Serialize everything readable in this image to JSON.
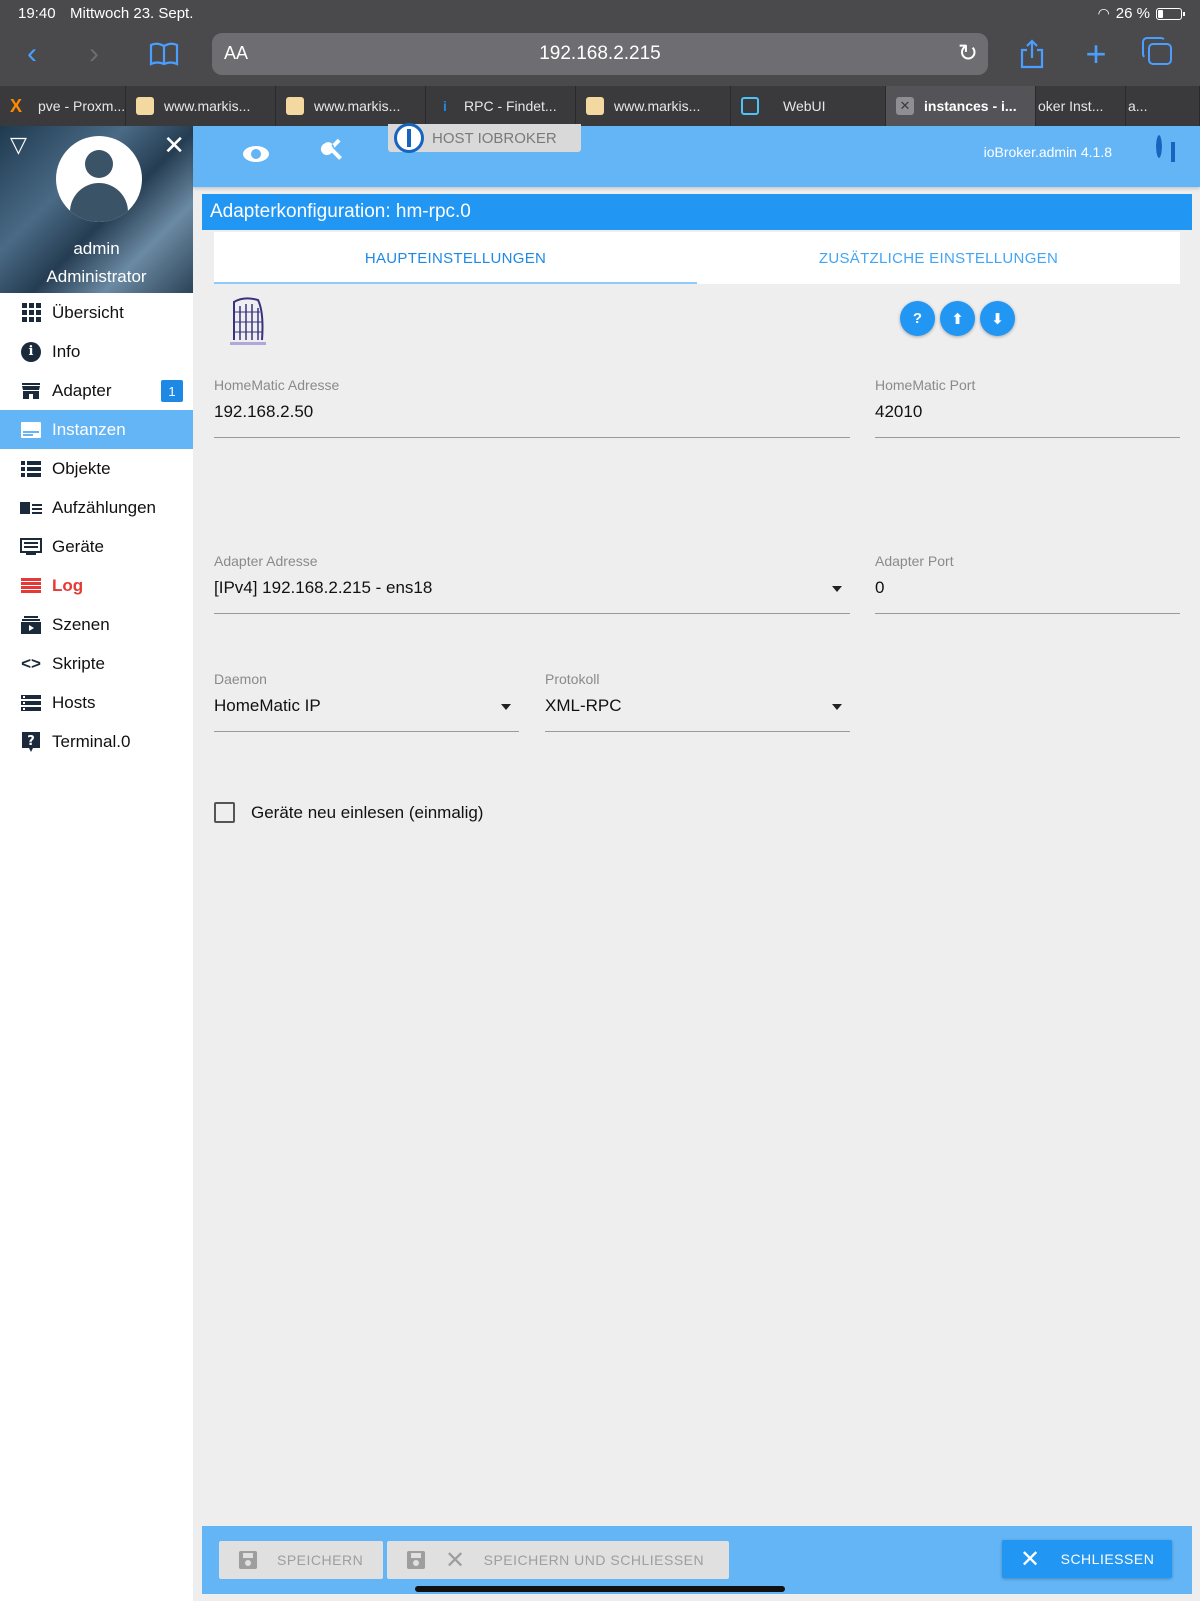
{
  "status": {
    "time": "19:40",
    "date": "Mittwoch 23. Sept.",
    "battery": "26 %"
  },
  "safari": {
    "aa_label": "AA",
    "url": "192.168.2.215"
  },
  "browser_tabs": [
    {
      "label": "pve - Proxm...",
      "icon_color": "#ff8a00"
    },
    {
      "label": "www.markis...",
      "icon_color": "#d46a2a"
    },
    {
      "label": "www.markis...",
      "icon_color": "#d46a2a"
    },
    {
      "label": "RPC - Findet...",
      "icon_color": "#1e88e5"
    },
    {
      "label": "www.markis...",
      "icon_color": "#d46a2a"
    },
    {
      "label": "WebUI",
      "icon_color": "#4fc3f7"
    },
    {
      "label": "instances - i...",
      "icon_color": "#8e8e93"
    },
    {
      "label": "oker Inst...",
      "icon_color": ""
    },
    {
      "label": "a...",
      "icon_color": ""
    }
  ],
  "sidebar": {
    "user_name": "admin",
    "user_role": "Administrator",
    "items": [
      {
        "label": "Übersicht",
        "icon": "grid-icon"
      },
      {
        "label": "Info",
        "icon": "info-icon"
      },
      {
        "label": "Adapter",
        "icon": "store-icon",
        "badge": "1"
      },
      {
        "label": "Instanzen",
        "icon": "instances-icon",
        "active": true
      },
      {
        "label": "Objekte",
        "icon": "list-icon"
      },
      {
        "label": "Aufzählungen",
        "icon": "enum-icon"
      },
      {
        "label": "Geräte",
        "icon": "devices-icon"
      },
      {
        "label": "Log",
        "icon": "log-icon"
      },
      {
        "label": "Szenen",
        "icon": "scenes-icon"
      },
      {
        "label": "Skripte",
        "icon": "code-icon"
      },
      {
        "label": "Hosts",
        "icon": "hosts-icon"
      },
      {
        "label": "Terminal.0",
        "icon": "help-icon"
      }
    ]
  },
  "topbar": {
    "host_label": "HOST IOBROKER",
    "version": "ioBroker.admin 4.1.8"
  },
  "config": {
    "title": "Adapterkonfiguration: hm-rpc.0",
    "tabs": [
      "HAUPTEINSTELLUNGEN",
      "ZUSÄTZLICHE EINSTELLUNGEN"
    ],
    "fields": {
      "hm_address": {
        "label": "HomeMatic Adresse",
        "value": "192.168.2.50"
      },
      "hm_port": {
        "label": "HomeMatic Port",
        "value": "42010"
      },
      "adapter_address": {
        "label": "Adapter Adresse",
        "value": "[IPv4] 192.168.2.215 - ens18"
      },
      "adapter_port": {
        "label": "Adapter Port",
        "value": "0"
      },
      "daemon": {
        "label": "Daemon",
        "value": "HomeMatic IP"
      },
      "protocol": {
        "label": "Protokoll",
        "value": "XML-RPC"
      }
    },
    "checkbox_label": "Geräte neu einlesen (einmalig)",
    "checkbox_checked": false
  },
  "footer": {
    "save": "SPEICHERN",
    "save_close": "SPEICHERN UND SCHLIESSEN",
    "close": "SCHLIESSEN"
  }
}
